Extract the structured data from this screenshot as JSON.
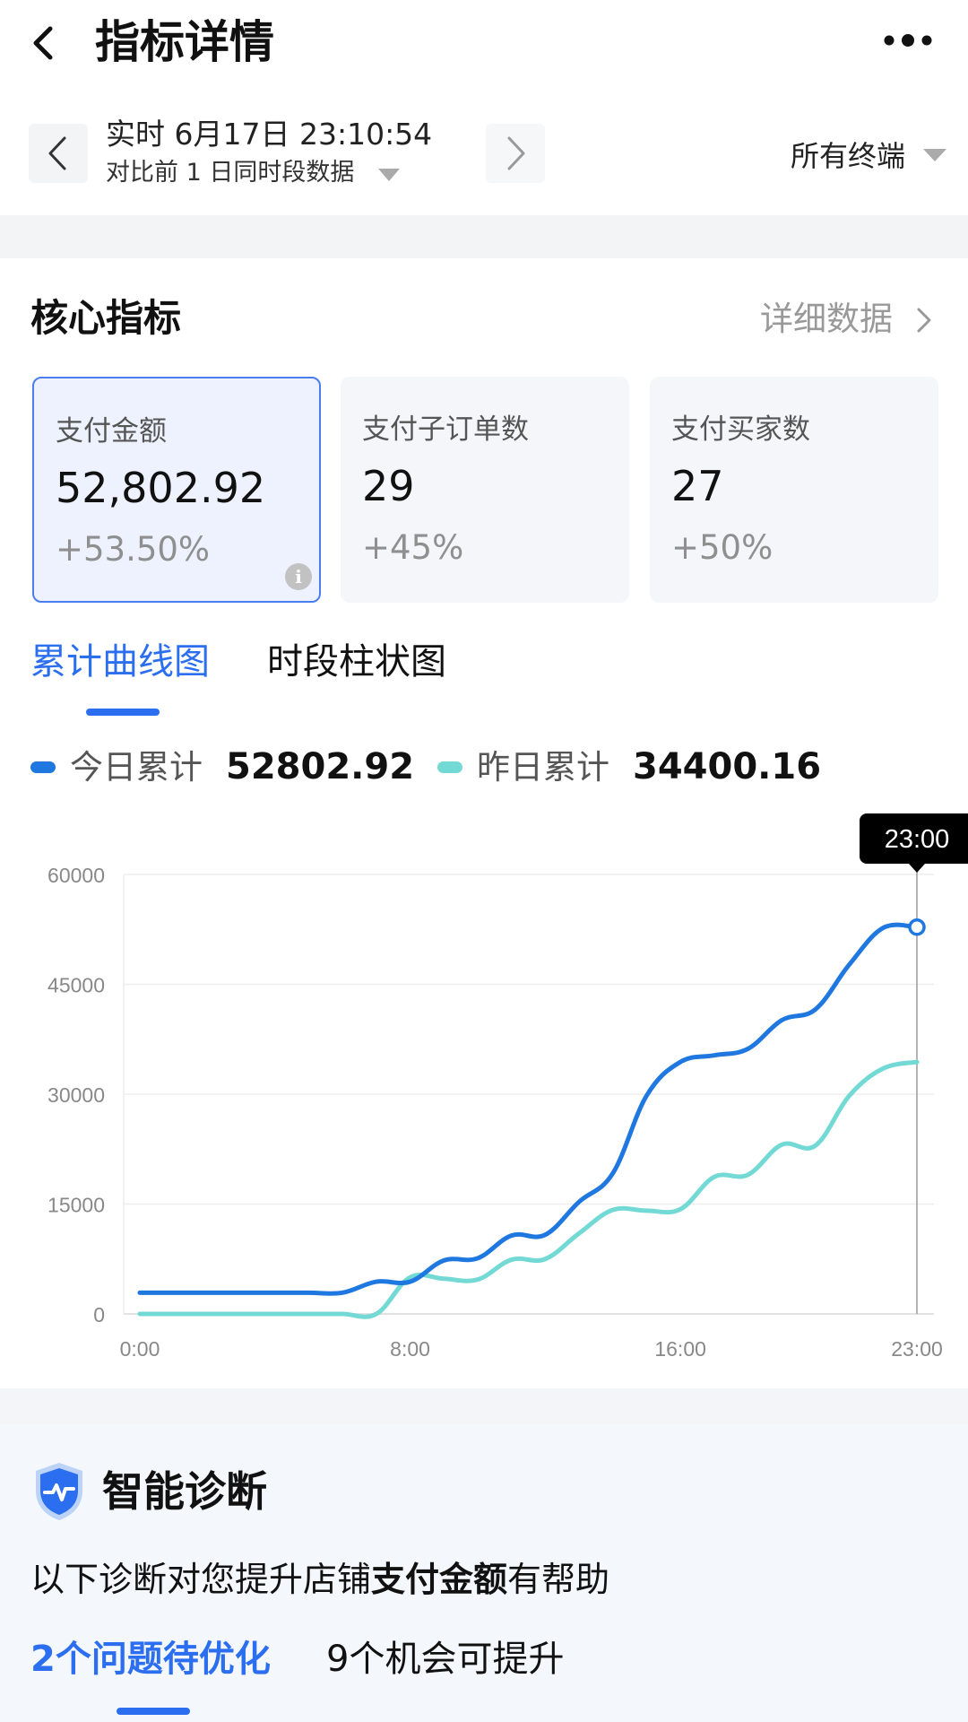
{
  "header": {
    "title": "指标详情"
  },
  "date_bar": {
    "current": "实时 6月17日 23:10:54",
    "compare": "对比前 1 日同时段数据",
    "terminal": "所有终端"
  },
  "core": {
    "title": "核心指标",
    "detail_link": "详细数据",
    "cards": [
      {
        "label": "支付金额",
        "value": "52,802.92",
        "change": "+53.50%",
        "active": true
      },
      {
        "label": "支付子订单数",
        "value": "29",
        "change": "+45%",
        "active": false
      },
      {
        "label": "支付买家数",
        "value": "27",
        "change": "+50%",
        "active": false
      }
    ],
    "info_icon_text": "i"
  },
  "chart_tabs": [
    {
      "label": "累计曲线图",
      "active": true
    },
    {
      "label": "时段柱状图",
      "active": false
    }
  ],
  "legend": {
    "today_label": "今日累计",
    "today_value": "52802.92",
    "yesterday_label": "昨日累计",
    "yesterday_value": "34400.16"
  },
  "chart_data": {
    "type": "line",
    "tooltip": "23:00",
    "x_ticks": [
      "0:00",
      "8:00",
      "16:00",
      "23:00"
    ],
    "ylim": [
      0,
      60000
    ],
    "y_ticks": [
      0,
      15000,
      30000,
      45000,
      60000
    ],
    "grid": true,
    "x_unit_hours": [
      0,
      23
    ],
    "series": [
      {
        "name": "今日累计",
        "color": "#1f78e0",
        "points": [
          [
            0,
            2900
          ],
          [
            1,
            2900
          ],
          [
            2,
            2900
          ],
          [
            3,
            2900
          ],
          [
            4,
            2900
          ],
          [
            5,
            2900
          ],
          [
            6,
            2900
          ],
          [
            7,
            4400
          ],
          [
            8,
            4400
          ],
          [
            9,
            7300
          ],
          [
            10,
            7600
          ],
          [
            11,
            10700
          ],
          [
            12,
            10800
          ],
          [
            13,
            15300
          ],
          [
            14,
            19200
          ],
          [
            15,
            29800
          ],
          [
            16,
            34400
          ],
          [
            17,
            35300
          ],
          [
            18,
            36200
          ],
          [
            19,
            40100
          ],
          [
            20,
            41600
          ],
          [
            21,
            47700
          ],
          [
            22,
            52700
          ],
          [
            23,
            52802.92
          ]
        ]
      },
      {
        "name": "昨日累计",
        "color": "#72d9d4",
        "points": [
          [
            0,
            0
          ],
          [
            1,
            0
          ],
          [
            2,
            0
          ],
          [
            3,
            0
          ],
          [
            4,
            0
          ],
          [
            5,
            0
          ],
          [
            6,
            0
          ],
          [
            7,
            0
          ],
          [
            8,
            5000
          ],
          [
            9,
            4800
          ],
          [
            10,
            4700
          ],
          [
            11,
            7400
          ],
          [
            12,
            7500
          ],
          [
            13,
            11000
          ],
          [
            14,
            14200
          ],
          [
            15,
            14100
          ],
          [
            16,
            14300
          ],
          [
            17,
            18700
          ],
          [
            18,
            19000
          ],
          [
            19,
            23100
          ],
          [
            20,
            23000
          ],
          [
            21,
            29800
          ],
          [
            22,
            33500
          ],
          [
            23,
            34400.16
          ]
        ]
      }
    ]
  },
  "diagnosis": {
    "title": "智能诊断",
    "desc_prefix": "以下诊断对您提升店铺",
    "desc_bold": "支付金额",
    "desc_suffix": "有帮助",
    "tabs": [
      {
        "label": "2个问题待优化",
        "active": true
      },
      {
        "label": "9个机会可提升",
        "active": false
      }
    ]
  }
}
